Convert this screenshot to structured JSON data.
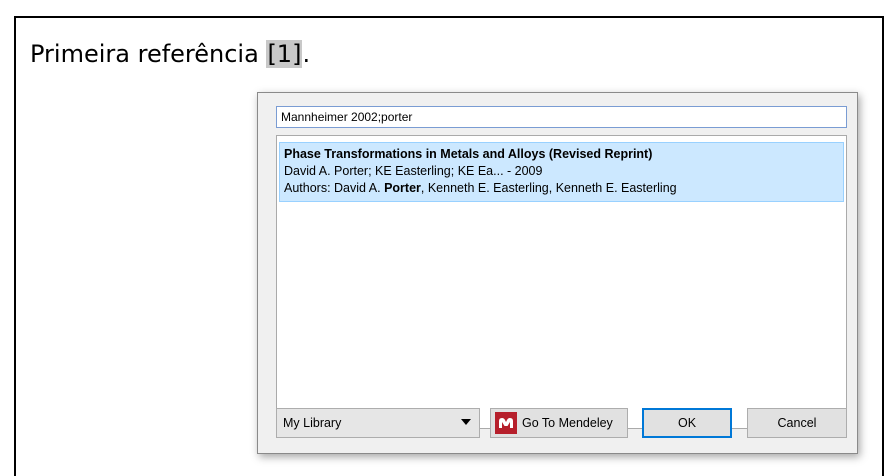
{
  "document": {
    "text": "Primeira referência ",
    "citation": "[1]",
    "trailing": "."
  },
  "dialog": {
    "search": {
      "value": "Mannheimer 2002;porter"
    },
    "results": [
      {
        "title": "Phase Transformations in Metals and Alloys (Revised Reprint)",
        "byline": "David A. Porter; KE Easterling; KE Ea... - 2009",
        "authors_prefix": "Authors: David A. ",
        "authors_highlight": "Porter",
        "authors_suffix": ", Kenneth E. Easterling, Kenneth E. Easterling"
      }
    ],
    "library_select": {
      "selected": "My Library"
    },
    "buttons": {
      "mendeley_label": "Go To Mendeley",
      "ok_label": "OK",
      "cancel_label": "Cancel"
    },
    "colors": {
      "selection_bg": "#cce8ff",
      "mendeley_red": "#b61f2b",
      "focus_blue": "#0078d7"
    },
    "icons": {
      "dropdown": "chevron-down-icon",
      "mendeley": "mendeley-logo-icon"
    }
  }
}
